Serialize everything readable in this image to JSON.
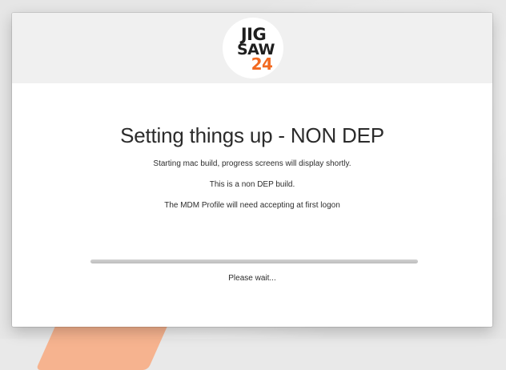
{
  "logo": {
    "line1": "JIG",
    "line2": "SAW",
    "line3": "24",
    "accent_color": "#f26a21"
  },
  "dialog": {
    "title": "Setting things up - NON DEP",
    "messages": [
      "Starting mac build, progress screens will display shortly.",
      "This is a non DEP build.",
      "The MDM Profile will need accepting at first logon"
    ],
    "progress_fraction": 1.0,
    "status_text": "Please wait..."
  }
}
